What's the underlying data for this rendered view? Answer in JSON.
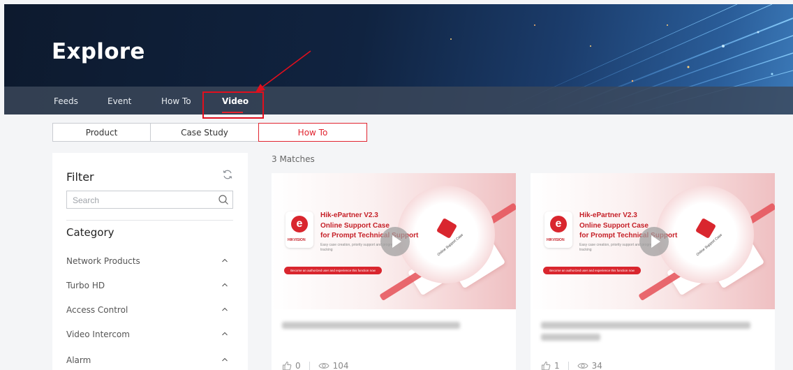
{
  "hero": {
    "title": "Explore"
  },
  "nav": {
    "items": [
      {
        "label": "Feeds"
      },
      {
        "label": "Event"
      },
      {
        "label": "How To"
      },
      {
        "label": "Video",
        "active": true
      }
    ]
  },
  "subtabs": [
    {
      "label": "Product"
    },
    {
      "label": "Case Study"
    },
    {
      "label": "How To",
      "active": true
    }
  ],
  "filter": {
    "title": "Filter",
    "search_placeholder": "Search",
    "category_title": "Category",
    "categories": [
      {
        "label": "Network Products"
      },
      {
        "label": "Turbo HD"
      },
      {
        "label": "Access Control"
      },
      {
        "label": "Video Intercom"
      },
      {
        "label": "Alarm"
      }
    ]
  },
  "results": {
    "matches": "3 Matches",
    "cards": [
      {
        "thumb_line1": "Hik-ePartner V2.3",
        "thumb_line2": "Online Support Case",
        "thumb_line3": "for Prompt Technical Support",
        "thumb_desc": "Easy case creation, priority support and progress tracking",
        "thumb_banner": "Become an authorized user and experience this function now",
        "thumb_circle_label": "Online Support Case",
        "thumb_brand": "HIKVISION",
        "likes": "0",
        "views": "104"
      },
      {
        "thumb_line1": "Hik-ePartner V2.3",
        "thumb_line2": "Online Support Case",
        "thumb_line3": "for Prompt Technical Support",
        "thumb_desc": "Easy case creation, priority support and progress tracking",
        "thumb_banner": "Become an authorized user and experience this function now",
        "thumb_circle_label": "Online Support Case",
        "thumb_brand": "HIKVISION",
        "likes": "1",
        "views": "34"
      }
    ]
  },
  "colors": {
    "accent": "#e1242f",
    "annotation": "#e10f1d",
    "hero_dark": "#0d1a2e",
    "nav_bg": "#3c485a"
  },
  "icons": [
    "refresh-icon",
    "search-icon",
    "chevron-up-icon",
    "thumbs-up-icon",
    "eye-icon",
    "play-icon"
  ]
}
